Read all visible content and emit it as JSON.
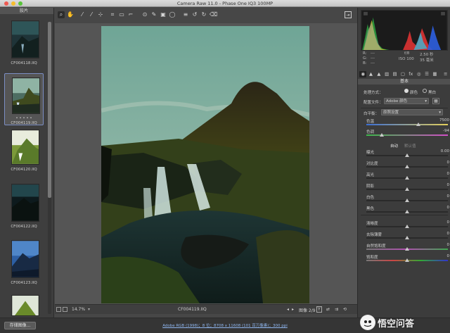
{
  "window": {
    "title": "Camera Raw 11.0 -  Phase One IQ3 100MP"
  },
  "filmstrip": {
    "header": "胶片",
    "thumbnails": [
      {
        "caption": "CF004118.IIQ"
      },
      {
        "caption": "CF004119.IIQ",
        "selected": true,
        "rating": "• • • • •"
      },
      {
        "caption": "CF004120.IIQ"
      },
      {
        "caption": "CF004122.IIQ"
      },
      {
        "caption": "CF004123.IIQ"
      }
    ]
  },
  "toolbar": {
    "tools": [
      "zoom-icon",
      "hand-icon",
      "white-balance-icon",
      "color-sampler-icon",
      "targeted-adjust-icon",
      "crop-icon",
      "straighten-icon",
      "spot-removal-icon",
      "red-eye-icon",
      "adjustment-brush-icon",
      "graduated-filter-icon",
      "radial-filter-icon",
      "preferences-icon",
      "rotate-ccw-icon",
      "rotate-cw-icon",
      "trash-icon"
    ],
    "export_icon": "open-export-icon"
  },
  "footer": {
    "zoom": "14.7%",
    "filename": "CF004119.IIQ",
    "image_count": "图像 2/9",
    "y_label": "Y"
  },
  "bottombar": {
    "save_label": "存储图像...",
    "info_link": "Adobe RGB (1998)；8 位；8708 x 11608 (101 百万像素)；300 ppi"
  },
  "watermark": {
    "text": "悟空问答"
  },
  "panel": {
    "meta": {
      "r": "R:",
      "g": "G:",
      "b": "B:",
      "dashes": "---",
      "aperture": "f/8",
      "shutter": "2.50 秒",
      "iso": "ISO 100",
      "focal": "35 毫米"
    },
    "section_title": "基本",
    "treatment_label": "处理方式：",
    "treatment_color": "颜色",
    "treatment_bw": "黑白",
    "profile_label": "配置文件：",
    "profile_value": "Adobe 颜色",
    "wb_label": "白平衡：",
    "wb_value": "原照设置",
    "temp_label": "色温",
    "temp_value": "7500",
    "tint_label": "色调",
    "tint_value": "-94",
    "auto_label": "自动",
    "default_label": "默认值",
    "sliders": [
      {
        "label": "曝光",
        "value": "0.00",
        "pos": 0.5
      },
      {
        "label": "对比度",
        "value": "0",
        "pos": 0.5
      },
      {
        "label": "高光",
        "value": "0",
        "pos": 0.5
      },
      {
        "label": "阴影",
        "value": "0",
        "pos": 0.5
      },
      {
        "label": "白色",
        "value": "0",
        "pos": 0.5
      },
      {
        "label": "黑色",
        "value": "0",
        "pos": 0.5
      }
    ],
    "sliders2": [
      {
        "label": "清晰度",
        "value": "0",
        "pos": 0.5
      },
      {
        "label": "去除薄雾",
        "value": "0",
        "pos": 0.5
      },
      {
        "label": "自然饱和度",
        "value": "0",
        "pos": 0.5
      },
      {
        "label": "饱和度",
        "value": "0",
        "pos": 0.5
      }
    ],
    "temp_pos": 0.64,
    "tint_pos": 0.19
  }
}
